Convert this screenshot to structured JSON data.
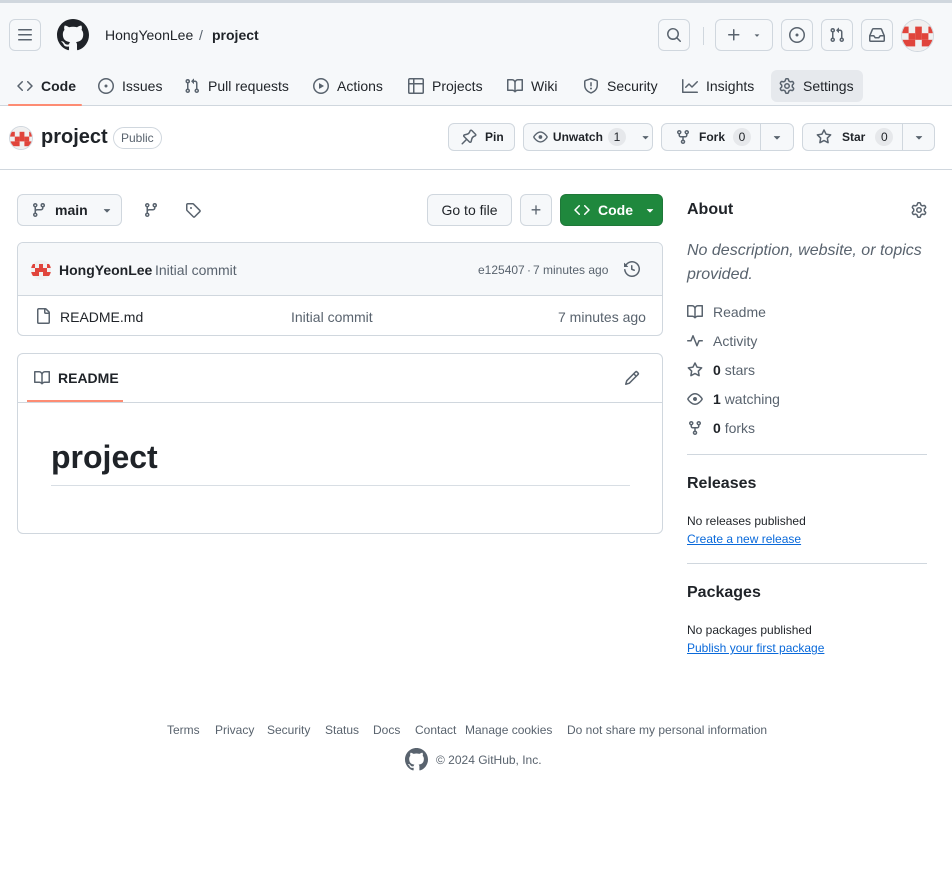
{
  "header": {
    "owner": "HongYeonLee",
    "separator": "/",
    "repo": "project"
  },
  "nav": {
    "tabs": [
      {
        "label": "Code"
      },
      {
        "label": "Issues"
      },
      {
        "label": "Pull requests"
      },
      {
        "label": "Actions"
      },
      {
        "label": "Projects"
      },
      {
        "label": "Wiki"
      },
      {
        "label": "Security"
      },
      {
        "label": "Insights"
      },
      {
        "label": "Settings"
      }
    ]
  },
  "repo": {
    "name": "project",
    "visibility": "Public",
    "pin_label": "Pin",
    "unwatch_label": "Unwatch",
    "watch_count": "1",
    "fork_label": "Fork",
    "fork_count": "0",
    "star_label": "Star",
    "star_count": "0"
  },
  "branch": {
    "name": "main",
    "go_to_file": "Go to file",
    "add_file": "+",
    "code_label": "Code"
  },
  "commit": {
    "author": "HongYeonLee",
    "message": "Initial commit",
    "sha": "e125407",
    "dot": "·",
    "time": "7 minutes ago"
  },
  "files": [
    {
      "name": "README.md",
      "message": "Initial commit",
      "time": "7 minutes ago"
    }
  ],
  "readme": {
    "tab_label": "README",
    "heading": "project"
  },
  "about": {
    "title": "About",
    "description": "No description, website, or topics provided.",
    "readme": "Readme",
    "activity": "Activity",
    "stars_count": "0",
    "stars_label": "stars",
    "watching_count": "1",
    "watching_label": "watching",
    "forks_count": "0",
    "forks_label": "forks"
  },
  "releases": {
    "title": "Releases",
    "empty": "No releases published",
    "link": "Create a new release"
  },
  "packages": {
    "title": "Packages",
    "empty": "No packages published",
    "link": "Publish your first package"
  },
  "footer": {
    "links": [
      "Terms",
      "Privacy",
      "Security",
      "Status",
      "Docs",
      "Contact",
      "Manage cookies",
      "Do not share my personal information"
    ],
    "copyright": "© 2024 GitHub, Inc."
  },
  "colors": {
    "accent_green": "#1f883d",
    "link_blue": "#0969da",
    "underline_orange": "#fd8c73"
  }
}
